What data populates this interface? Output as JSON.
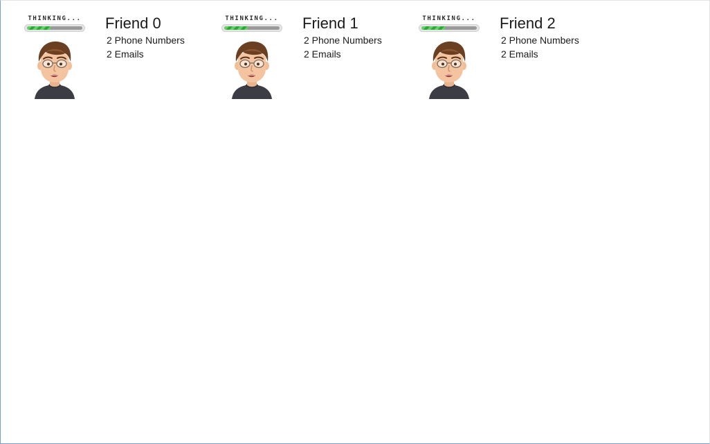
{
  "status_label": "THINKING...",
  "progress_fraction": 0.42,
  "colors": {
    "progress_fill": "#4cc552",
    "progress_track": "#9a9a9a",
    "window_border": "#7a9ccc"
  },
  "friends": [
    {
      "name": "Friend 0",
      "phones": "2 Phone Numbers",
      "emails": "2 Emails"
    },
    {
      "name": "Friend 1",
      "phones": "2 Phone Numbers",
      "emails": "2 Emails"
    },
    {
      "name": "Friend 2",
      "phones": "2 Phone Numbers",
      "emails": "2 Emails"
    }
  ]
}
